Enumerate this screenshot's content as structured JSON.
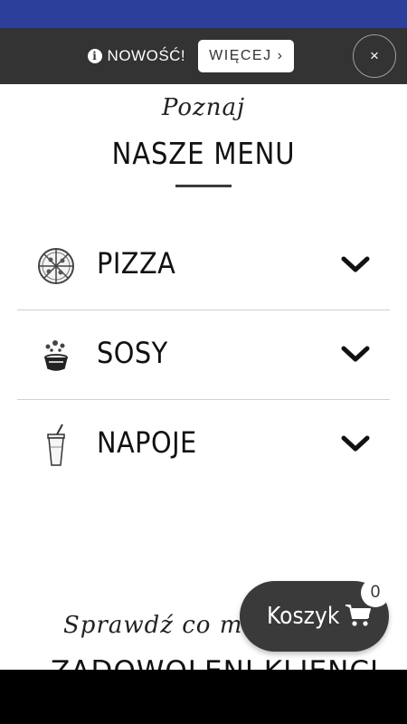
{
  "colors": {
    "status_bar": "#2b3f9b",
    "promo_bar": "#333333",
    "cart_button": "#3a3a3a",
    "nav_bar": "#000000"
  },
  "promo": {
    "info_icon": "info-circle-icon",
    "info_glyph": "i",
    "text": "NOWOŚĆ!",
    "more_label": "WIĘCEJ",
    "more_chevron": "›",
    "close_label": "×"
  },
  "menu": {
    "kicker": "Poznaj",
    "title": "NASZE MENU",
    "categories": [
      {
        "label": "PIZZA",
        "icon": "pizza-icon"
      },
      {
        "label": "SOSY",
        "icon": "sauce-cup-icon"
      },
      {
        "label": "NAPOJE",
        "icon": "drink-cup-icon"
      }
    ]
  },
  "reviews": {
    "kicker": "Sprawdź co mów",
    "title": "ZADOWOLENI KLIENCI"
  },
  "cart": {
    "label": "Koszyk",
    "icon": "shopping-cart-icon",
    "count": "0"
  }
}
